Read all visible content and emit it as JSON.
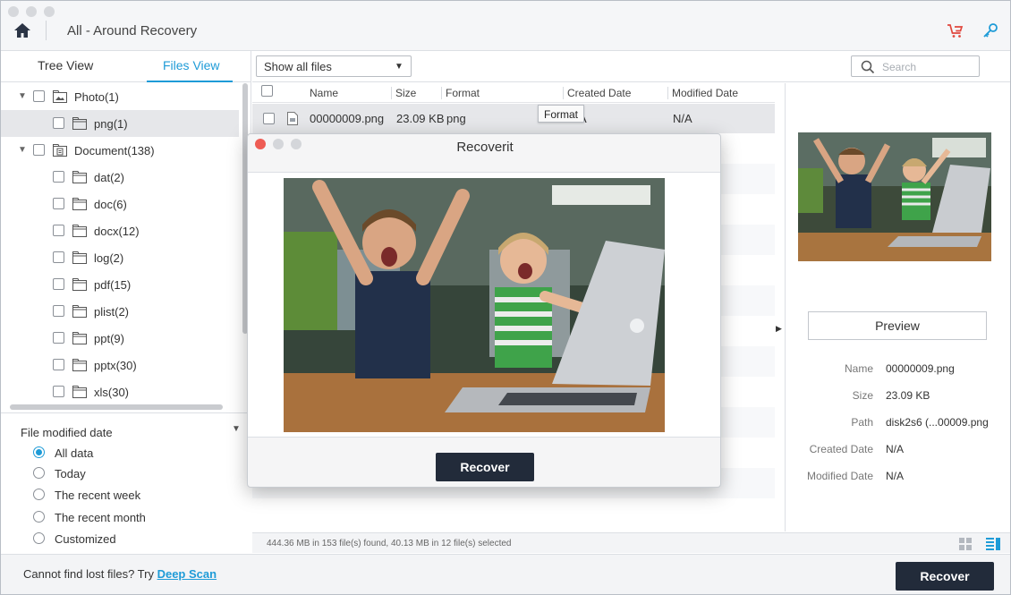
{
  "window": {
    "breadcrumb": "All - Around Recovery",
    "icons": {
      "home": "home-icon",
      "cart": "cart-icon",
      "key": "key-icon"
    },
    "colors": {
      "accent": "#1e9bd7",
      "cart": "#e0473c",
      "dark_button": "#222b3a"
    }
  },
  "left_panel": {
    "tabs": [
      {
        "label": "Tree View",
        "active": false
      },
      {
        "label": "Files View",
        "active": true
      }
    ],
    "tree": [
      {
        "label": "Photo(1)",
        "level": 0,
        "expanded": true,
        "icon": "photo-folder-icon"
      },
      {
        "label": "png(1)",
        "level": 1,
        "selected": true,
        "icon": "folder-icon"
      },
      {
        "label": "Document(138)",
        "level": 0,
        "expanded": true,
        "icon": "document-folder-icon"
      },
      {
        "label": "dat(2)",
        "level": 1,
        "icon": "folder-icon"
      },
      {
        "label": "doc(6)",
        "level": 1,
        "icon": "folder-icon"
      },
      {
        "label": "docx(12)",
        "level": 1,
        "icon": "folder-icon"
      },
      {
        "label": "log(2)",
        "level": 1,
        "icon": "folder-icon"
      },
      {
        "label": "pdf(15)",
        "level": 1,
        "icon": "folder-icon"
      },
      {
        "label": "plist(2)",
        "level": 1,
        "icon": "folder-icon"
      },
      {
        "label": "ppt(9)",
        "level": 1,
        "icon": "folder-icon"
      },
      {
        "label": "pptx(30)",
        "level": 1,
        "icon": "folder-icon"
      },
      {
        "label": "xls(30)",
        "level": 1,
        "icon": "folder-icon"
      }
    ],
    "filter": {
      "title": "File modified date",
      "options": [
        {
          "label": "All data",
          "selected": true
        },
        {
          "label": "Today",
          "selected": false
        },
        {
          "label": "The recent week",
          "selected": false
        },
        {
          "label": "The recent month",
          "selected": false
        },
        {
          "label": "Customized",
          "selected": false
        }
      ]
    }
  },
  "toolbar": {
    "filter_select": "Show all files",
    "search_placeholder": "Search"
  },
  "file_list": {
    "columns": [
      "Name",
      "Size",
      "Format",
      "Created Date",
      "Modified Date"
    ],
    "rows": [
      {
        "name": "00000009.png",
        "size": "23.09 KB",
        "format": "png",
        "created": "N/A",
        "modified": "N/A"
      }
    ],
    "tooltip": "Format"
  },
  "status": {
    "text": "444.36 MB in 153 file(s) found, 40.13 MB in 12 file(s) selected"
  },
  "preview_pane": {
    "button": "Preview",
    "info": [
      {
        "key": "Name",
        "value": "00000009.png"
      },
      {
        "key": "Size",
        "value": "23.09 KB"
      },
      {
        "key": "Path",
        "value": "disk2s6 (...00009.png"
      },
      {
        "key": "Created Date",
        "value": "N/A"
      },
      {
        "key": "Modified Date",
        "value": "N/A"
      }
    ]
  },
  "bottom": {
    "hint_prefix": "Cannot find lost files? Try ",
    "hint_link": "Deep Scan",
    "recover": "Recover"
  },
  "modal": {
    "title": "Recoverit",
    "recover": "Recover"
  }
}
